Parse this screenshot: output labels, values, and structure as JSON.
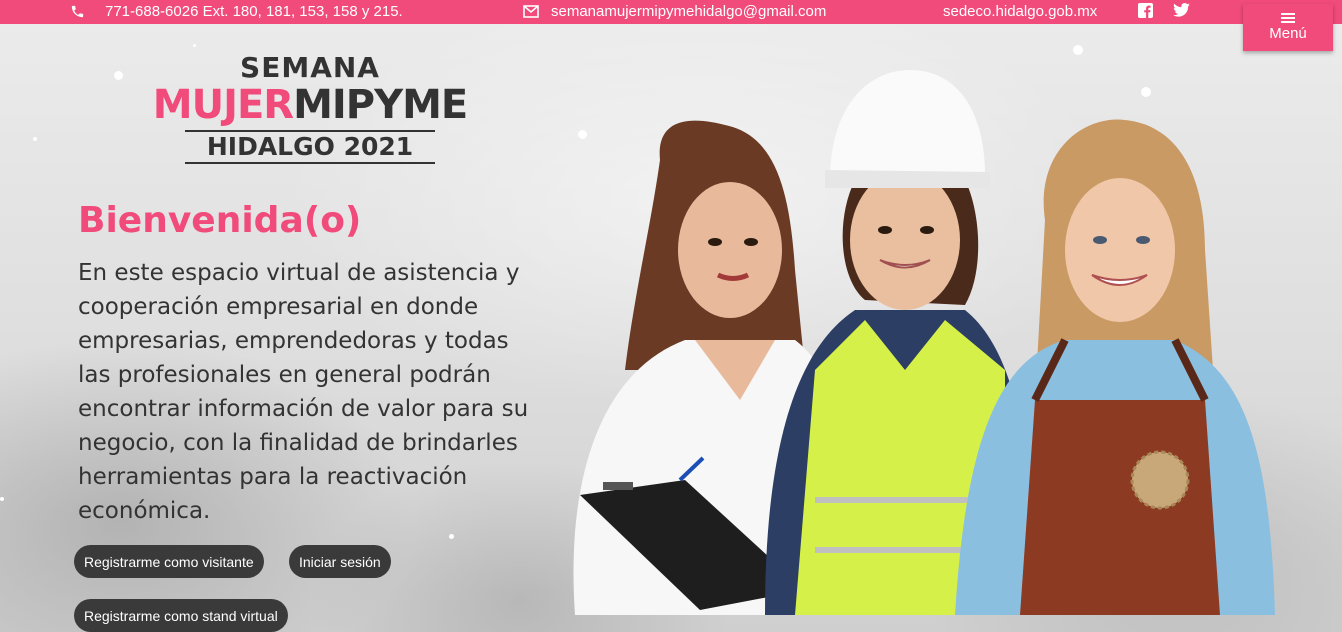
{
  "topbar": {
    "phone": "771-688-6026 Ext. 180, 181, 153, 158 y 215.",
    "email": "semanamujermipymehidalgo@gmail.com",
    "website": "sedeco.hidalgo.gob.mx",
    "icons": [
      "phone-icon",
      "envelope-icon",
      "facebook-icon",
      "twitter-icon"
    ]
  },
  "menu": {
    "label": "Menú"
  },
  "logo": {
    "line1": "SEMANA",
    "line2_pink": "MUJER",
    "line2_dark": "MIPYME",
    "line3": "HIDALGO 2021"
  },
  "welcome": {
    "title": "Bienvenida(o)",
    "text": "En este espacio virtual de asistencia y cooperación empresarial en donde empresarias, emprendedoras y todas las profesionales en general podrán encontrar información de valor para su negocio, con la finalidad de brindarles herramientas para la reactivación económica."
  },
  "buttons": {
    "register_visitor": "Registrarme como visitante",
    "login": "Iniciar sesión",
    "register_stand": "Registrarme como stand virtual"
  },
  "colors": {
    "brand_pink": "#f04b7a",
    "dark": "#333333",
    "button_dark": "#3a3a3a"
  }
}
